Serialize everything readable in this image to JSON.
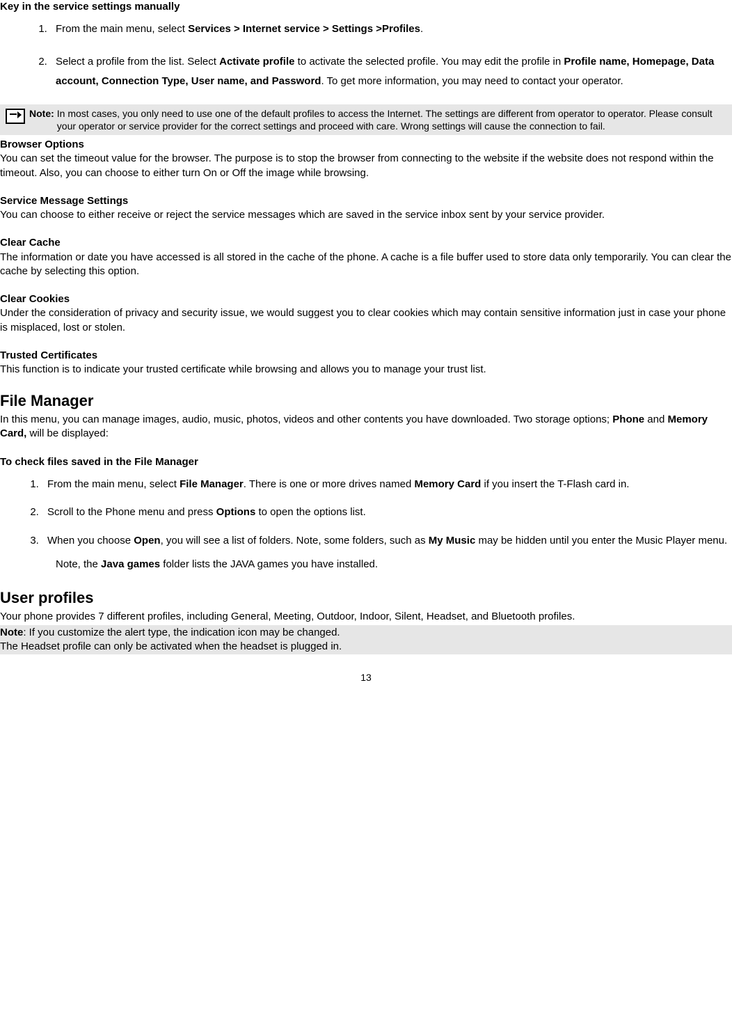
{
  "s1": {
    "heading": "Key in the service settings manually",
    "items": [
      "From the main menu, select <b>Services > Internet service > Settings >Profiles</b>.",
      "Select a profile from the list. Select <b>Activate profile</b> to activate the selected profile. You may edit the profile in <b>Profile name, Homepage, Data account, Connection Type, User name, and Password</b>. To get more information, you may need to contact your operator."
    ]
  },
  "note1": {
    "label": "Note",
    "text": "In most cases, you only need to use one of the default profiles to access the Internet. The settings are different from operator to operator. Please consult your operator or service provider for the correct settings and proceed with care. Wrong settings will cause the connection to fail."
  },
  "browser": {
    "heading": "Browser Options",
    "text": "You can set the timeout value for the browser. The purpose is to stop the browser from connecting to the website if the website does not respond within the timeout. Also, you can choose to either turn On or Off the image while browsing."
  },
  "service_msg": {
    "heading": "Service Message Settings",
    "text": "You can choose to either receive or reject the service messages which are saved in the service inbox sent by your service provider."
  },
  "cache": {
    "heading": "Clear Cache",
    "text": "The information or date you have accessed is all stored in the cache of the phone. A cache is a file buffer used to store data only temporarily. You can clear the cache by selecting this option."
  },
  "cookies": {
    "heading": "Clear Cookies",
    "text": "Under the consideration of privacy and security issue, we would suggest you to clear cookies which may contain sensitive information just in case your phone is misplaced, lost or stolen."
  },
  "certs": {
    "heading": "Trusted Certificates",
    "text": "This function is to indicate your trusted certificate while browsing and allows you to manage your trust list."
  },
  "fm": {
    "heading": "File Manager",
    "intro": "In this menu, you can manage images, audio, music, photos, videos and other contents you have downloaded. Two storage options; <b>Phone</b> and <b>Memory Card,</b> will be displayed:",
    "check_heading": "To check files saved in the File Manager",
    "items": [
      "From the main menu, select <b>File Manager</b>. There is one or more drives named <b>Memory Card</b> if you insert the T-Flash card in.",
      "Scroll to the Phone menu and press <b>Options</b> to open the options list.",
      "When you choose <b>Open</b>, you will see a list of folders. Note, some folders, such as <b>My Music</b> may be hidden until you enter the Music Player menu."
    ],
    "note_line": "Note, the <b>Java games</b> folder lists the JAVA games you have installed."
  },
  "up": {
    "heading": "User profiles",
    "text": "Your phone provides 7 different profiles, including General, Meeting, Outdoor, Indoor, Silent, Headset, and Bluetooth profiles.",
    "gray1": "<b>Note</b>: If you customize the alert type, the indication icon may be changed.",
    "gray2": "The Headset profile can only be activated when the headset is plugged in."
  },
  "page_number": "13"
}
